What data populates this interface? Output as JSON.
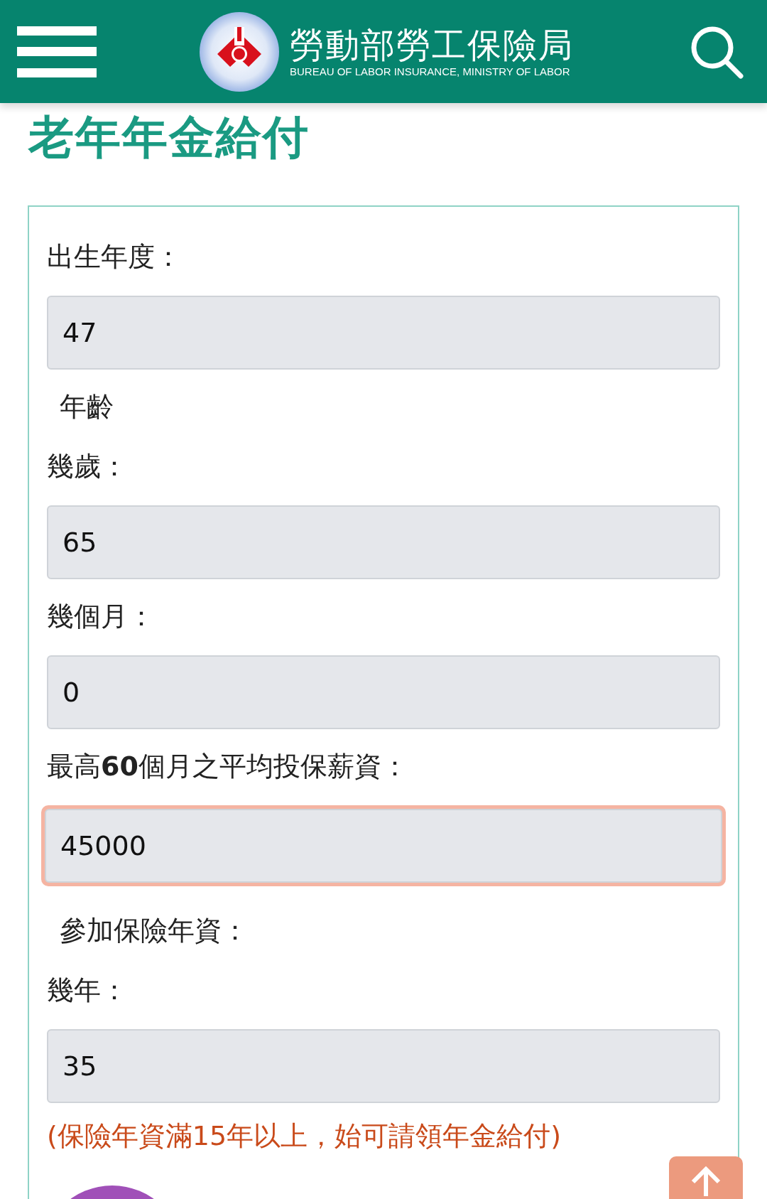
{
  "header": {
    "title": "勞動部勞工保險局",
    "subtitle": "BUREAU OF LABOR INSURANCE, MINISTRY OF LABOR"
  },
  "page_title": "老年年金給付",
  "form": [
    {
      "kind": "label",
      "text": "出生年度："
    },
    {
      "kind": "input",
      "value": "47",
      "focused": false
    },
    {
      "kind": "heading",
      "text": "年齡"
    },
    {
      "kind": "label",
      "text": "幾歲："
    },
    {
      "kind": "input",
      "value": "65",
      "focused": false
    },
    {
      "kind": "label",
      "text": "幾個月："
    },
    {
      "kind": "input",
      "value": "0",
      "focused": false
    },
    {
      "kind": "label",
      "text": "最高**60**個月之平均投保薪資："
    },
    {
      "kind": "input",
      "value": "45000",
      "focused": true
    },
    {
      "kind": "heading",
      "text": "參加保險年資："
    },
    {
      "kind": "label",
      "text": "幾年："
    },
    {
      "kind": "input",
      "value": "35",
      "focused": false
    },
    {
      "kind": "note",
      "text": "(保險年資滿15年以上，始可請領年金給付)"
    }
  ]
}
